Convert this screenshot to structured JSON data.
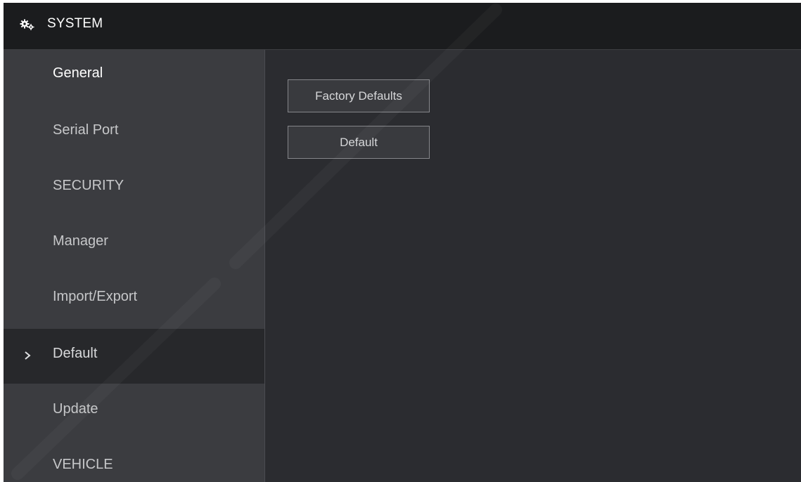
{
  "header": {
    "title": "SYSTEM",
    "icon": "gears-icon"
  },
  "sidebar": {
    "items": [
      {
        "label": "General"
      },
      {
        "label": "Serial Port"
      },
      {
        "label": "SECURITY"
      },
      {
        "label": "Manager"
      },
      {
        "label": "Import/Export"
      },
      {
        "label": "Default",
        "active": true
      },
      {
        "label": "Update"
      },
      {
        "label": "VEHICLE"
      }
    ],
    "active_indicator": "chevron-right-icon"
  },
  "main": {
    "factory_defaults_label": "Factory Defaults",
    "default_label": "Default"
  },
  "colors": {
    "header_bg": "#1b1c1e",
    "sidebar_bg": "#3b3c40",
    "active_item_bg": "#27282b",
    "content_bg": "#2b2c30",
    "button_border": "#85868a"
  }
}
